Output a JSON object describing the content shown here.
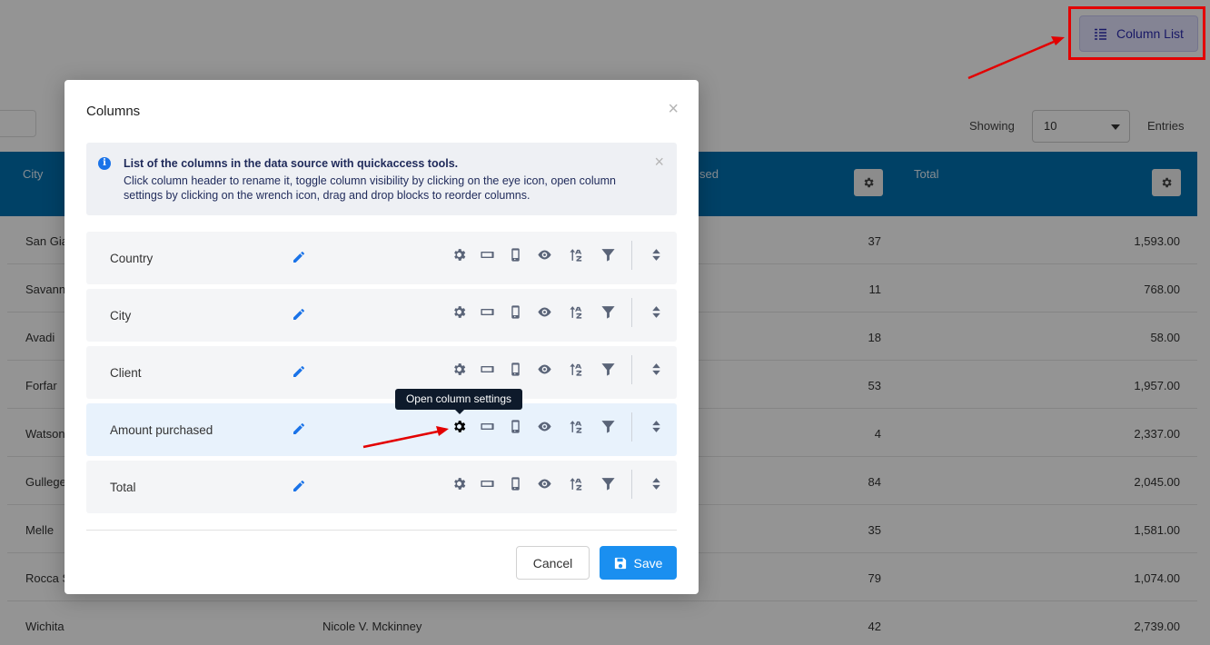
{
  "toolbar": {
    "column_list_label": "Column List"
  },
  "table": {
    "showing_label": "Showing",
    "entries_value": "10",
    "entries_label": "Entries",
    "headers": {
      "city": "City",
      "amount_partial": "sed",
      "total": "Total"
    },
    "rows": [
      {
        "city": "San Gia",
        "client": "",
        "amount": "37",
        "total": "1,593.00"
      },
      {
        "city": "Savann",
        "client": "",
        "amount": "11",
        "total": "768.00"
      },
      {
        "city": "Avadi",
        "client": "",
        "amount": "18",
        "total": "58.00"
      },
      {
        "city": "Forfar",
        "client": "",
        "amount": "53",
        "total": "1,957.00"
      },
      {
        "city": "Watson",
        "client": "",
        "amount": "4",
        "total": "2,337.00"
      },
      {
        "city": "Gullege",
        "client": "",
        "amount": "84",
        "total": "2,045.00"
      },
      {
        "city": "Melle",
        "client": "",
        "amount": "35",
        "total": "1,581.00"
      },
      {
        "city": "Rocca S",
        "client": "",
        "amount": "79",
        "total": "1,074.00"
      },
      {
        "city": "Wichita",
        "client": "Nicole V. Mckinney",
        "amount": "42",
        "total": "2,739.00"
      }
    ]
  },
  "modal": {
    "title": "Columns",
    "close_symbol": "×",
    "info": {
      "icon": "i",
      "title": "List of the columns in the data source with quickaccess tools.",
      "body": "Click column header to rename it, toggle column visibility by clicking on the eye icon, open column settings by clicking on the wrench icon, drag and drop blocks to reorder columns."
    },
    "columns": [
      {
        "name": "Country"
      },
      {
        "name": "City"
      },
      {
        "name": "Client"
      },
      {
        "name": "Amount purchased"
      },
      {
        "name": "Total"
      }
    ],
    "tooltip": "Open column settings",
    "cancel_label": "Cancel",
    "save_label": "Save"
  },
  "colors": {
    "header_blue": "#0070b0",
    "primary": "#1a8ff0",
    "annotation_red": "#e30000"
  }
}
